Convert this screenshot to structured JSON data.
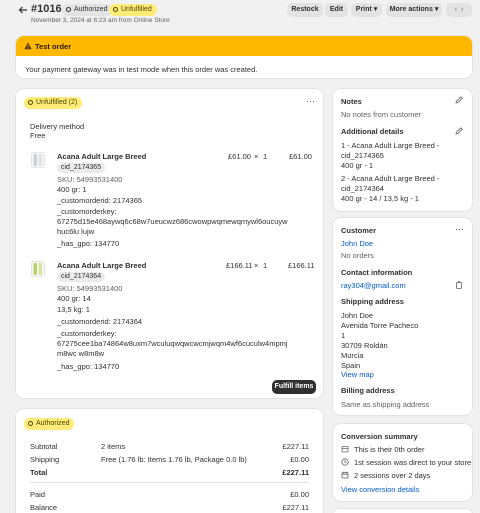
{
  "header": {
    "order_number": "#1016",
    "badge_authorized": "Authorized",
    "badge_unfulfilled": "Unfulfilled",
    "subtitle": "November 3, 2024 at 6:23 am from Online Store",
    "restock": "Restock",
    "edit": "Edit",
    "print": "Print",
    "more_actions": "More actions"
  },
  "test_order": {
    "title": "Test order",
    "message": "Your payment gateway was in test mode when this order was created."
  },
  "fulfillment": {
    "badge": "Unfulfilled (2)",
    "delivery_label": "Delivery method",
    "delivery_value": "Free",
    "fulfill_button": "Fulfill items",
    "items": [
      {
        "name": "Acana Adult Large Breed",
        "code": "cid_2174365",
        "price": "£61.00",
        "times": "×",
        "qty": "1",
        "total": "£61.00",
        "sku": "SKU: 54993531400",
        "variant1": "400 gr: 1",
        "prop1": "_customorderid: 2174365",
        "prop2_label": "_customorderkey:",
        "prop2_value": "67275d15e468aywq6c68w7ueucwz686cwowpwqmewqmywl6oucuywhuc6lu lujw",
        "prop3": "_has_gpo: 134770"
      },
      {
        "name": "Acana Adult Large Breed",
        "code": "cid_2174364",
        "price": "£166.11",
        "times": "×",
        "qty": "1",
        "total": "£166.11",
        "sku": "SKU: 54993531400",
        "variant1": "400 gr: 14",
        "variant2": "13,5 kg: 1",
        "prop1": "_customorderid: 2174364",
        "prop2_label": "_customorderkey:",
        "prop2_value": "67275cee1ba74864w8uxm7wculuqwqwcwcmjwqm4wf6cuculw4mpmjm8wc w8m8w",
        "prop3": "_has_gpo: 134770"
      }
    ]
  },
  "payment": {
    "badge": "Authorized",
    "rows": [
      {
        "label": "Subtotal",
        "desc": "2 items",
        "amount": "£227.11"
      },
      {
        "label": "Shipping",
        "desc": "Free (1.76 lb: Items 1.76 lb, Package 0.0 lb)",
        "amount": "£0.00"
      },
      {
        "label": "Total",
        "desc": "",
        "amount": "£227.11"
      },
      {
        "label": "Paid",
        "desc": "",
        "amount": "£0.00"
      },
      {
        "label": "Balance",
        "desc": "",
        "amount": "£227.11"
      }
    ]
  },
  "notes": {
    "title": "Notes",
    "empty": "No notes from customer",
    "additional_title": "Additional details",
    "details": [
      "1 - Acana Adult Large Breed -",
      "cid_2174365",
      "400 gr - 1",
      "2 - Acana Adult Large Breed -",
      "cid_2174364",
      "400 gr - 14 / 13,5 kg - 1"
    ]
  },
  "customer": {
    "title": "Customer",
    "name": "John Doe",
    "orders": "No orders",
    "contact_title": "Contact information",
    "email": "ray304@gmail.com",
    "shipping_title": "Shipping address",
    "address": [
      "John Doe",
      "Avenida Torre Pacheco",
      "1",
      "30709 Roldán",
      "Murcia",
      "Spain"
    ],
    "view_map": "View map",
    "billing_title": "Billing address",
    "billing_value": "Same as shipping address"
  },
  "conversion": {
    "title": "Conversion summary",
    "lines": [
      "This is their 0th order",
      "1st session was direct to your store",
      "2 sessions over 2 days"
    ],
    "link": "View conversion details"
  },
  "colors": {
    "warning": "#ffb800",
    "link": "#005bd3",
    "badge_yellow": "#ffeb78"
  }
}
